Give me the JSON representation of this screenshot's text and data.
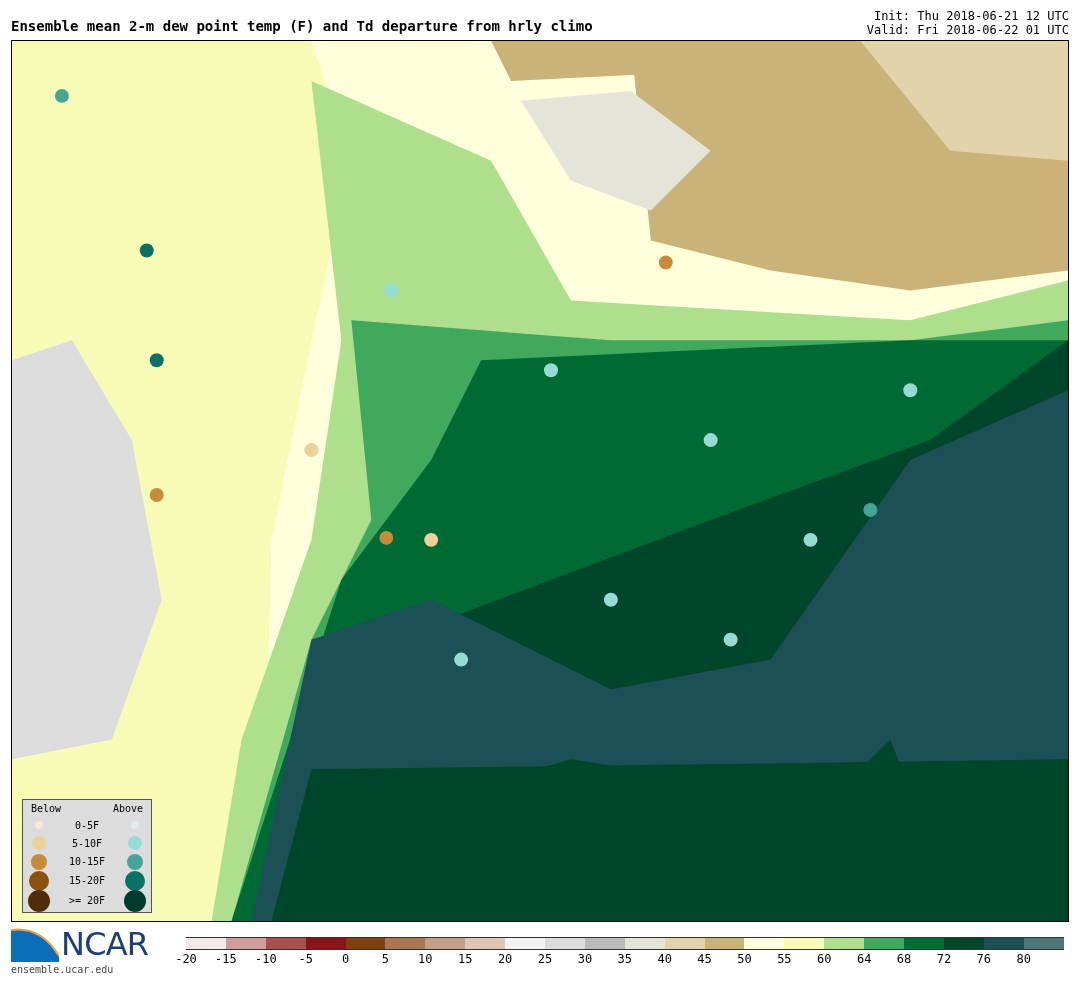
{
  "title": "Ensemble mean 2-m dew point temp (F) and Td departure from hrly climo",
  "init": "Init: Thu 2018-06-21 12 UTC",
  "valid": "Valid: Fri 2018-06-22 01 UTC",
  "legend": {
    "below_heading": "Below",
    "above_heading": "Above",
    "rows": [
      {
        "label": "0-5F",
        "below": {
          "color": "#f3ecdc"
        },
        "above": {
          "color": "#dcefef"
        }
      },
      {
        "label": "5-10F",
        "below": {
          "color": "#ead29a"
        },
        "above": {
          "color": "#96dcd4"
        }
      },
      {
        "label": "10-15F",
        "below": {
          "color": "#c68c3c"
        },
        "above": {
          "color": "#45a698"
        }
      },
      {
        "label": "15-20F",
        "below": {
          "color": "#8c500f"
        },
        "above": {
          "color": "#087266"
        }
      },
      {
        "label": ">= 20F",
        "below": {
          "color": "#4f2d08"
        },
        "above": {
          "color": "#013b2f"
        }
      }
    ]
  },
  "logo": {
    "text": "NCAR",
    "url": "ensemble.ucar.edu"
  },
  "colorbar": [
    {
      "label": "-20",
      "color": "#f3e9e9"
    },
    {
      "label": "-15",
      "color": "#d09c9c"
    },
    {
      "label": "-10",
      "color": "#a84f4f"
    },
    {
      "label": "-5",
      "color": "#8a141a"
    },
    {
      "label": "0",
      "color": "#7f3f0f"
    },
    {
      "label": "5",
      "color": "#a87650"
    },
    {
      "label": "10",
      "color": "#c49e86"
    },
    {
      "label": "15",
      "color": "#dfc6b4"
    },
    {
      "label": "20",
      "color": "#f2f2f2"
    },
    {
      "label": "25",
      "color": "#dcdcdc"
    },
    {
      "label": "30",
      "color": "#bababa"
    },
    {
      "label": "35",
      "color": "#e4e4d8"
    },
    {
      "label": "40",
      "color": "#e2d3ab"
    },
    {
      "label": "45",
      "color": "#c9b378"
    },
    {
      "label": "50",
      "color": "#ffffdc"
    },
    {
      "label": "55",
      "color": "#f7fbb5"
    },
    {
      "label": "60",
      "color": "#addf8d"
    },
    {
      "label": "64",
      "color": "#40a95e"
    },
    {
      "label": "68",
      "color": "#006a35"
    },
    {
      "label": "72",
      "color": "#00462a"
    },
    {
      "label": "76",
      "color": "#1a5056"
    },
    {
      "label": "80",
      "color": "#4d7878"
    }
  ]
}
